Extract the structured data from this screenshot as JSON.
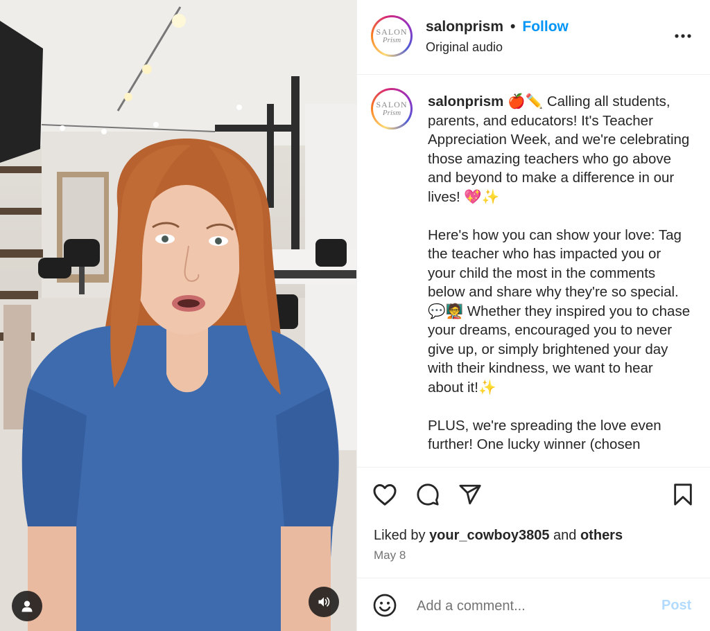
{
  "post": {
    "username": "salonprism",
    "separator": "•",
    "follow_label": "Follow",
    "audio_label": "Original audio",
    "avatar": {
      "line1": "SALON",
      "line2": "Prism"
    },
    "more_icon": "more-horizontal-icon"
  },
  "caption": {
    "username": "salonprism",
    "text": " 🍎✏️ Calling all students, parents, and educators! It's Teacher Appreciation Week, and we're celebrating those amazing teachers who go above and beyond to make a difference in our lives! 💖✨\n\nHere's how you can show your love: Tag the teacher who has impacted you or your child the most in the comments below and share why they're so special. 💬🧑‍🏫 Whether they inspired you to chase your dreams, encouraged you to never give up, or simply brightened your day with their kindness, we want to hear about it!✨\n\nPLUS, we're spreading the love even further! One lucky winner (chosen"
  },
  "actions": {
    "like_icon": "heart-icon",
    "comment_icon": "comment-icon",
    "share_icon": "paper-plane-icon",
    "save_icon": "bookmark-icon"
  },
  "likes": {
    "prefix": "Liked by ",
    "user": "your_cowboy3805",
    "middle": " and ",
    "others": "others"
  },
  "date": "May 8",
  "comment": {
    "placeholder": "Add a comment...",
    "post_label": "Post",
    "emoji_icon": "smiley-icon"
  },
  "media": {
    "user_icon": "person-icon",
    "sound_icon": "speaker-icon"
  },
  "colors": {
    "link_blue": "#0095f6",
    "post_disabled": "#b3dbff",
    "text": "#262626",
    "muted": "#737373",
    "border": "#efefef"
  }
}
